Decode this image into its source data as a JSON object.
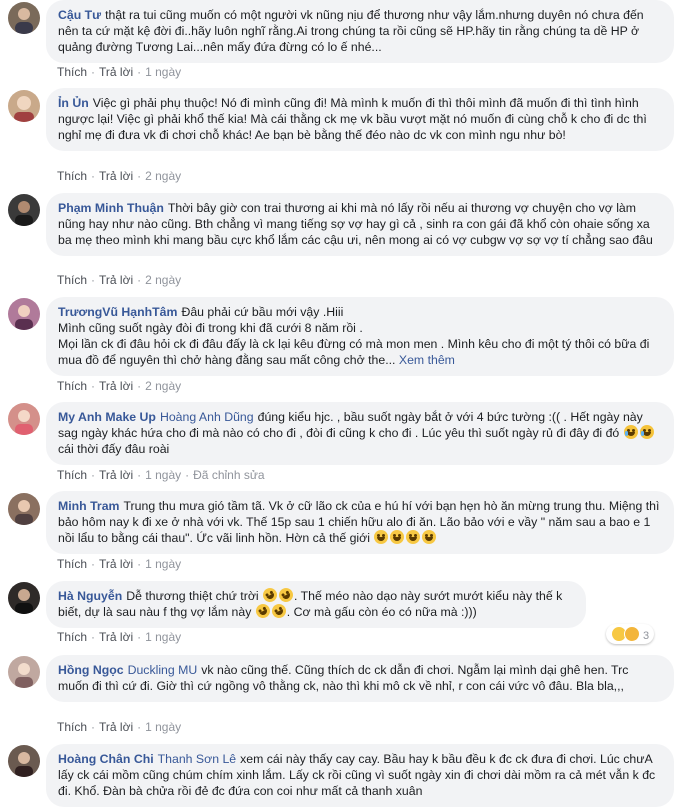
{
  "actions": {
    "like": "Thích",
    "reply": "Trả lời",
    "sep": "·"
  },
  "comments": [
    {
      "author": "Cậu Tư",
      "mention": "",
      "text": "thật ra tui cũng muốn có một người vk nũng nịu để thương như vậy lắm.nhưng duyên nó chưa đến nên ta cứ mặt kệ đời đi..hãy luôn nghĩ rằng.Ai trong chúng ta rồi cũng sẽ HP.hãy tin rằng chúng ta dề HP ở quảng đường Tương Lai...nên mấy đứa đừng có lo ế nhé...",
      "time": "1 ngày",
      "avatar_color": "#7a6a5a"
    },
    {
      "author": "Ỉn Ủn",
      "mention": "",
      "text": "Việc gì phải phụ thuộc! Nó đi mình cũng đi! Mà mình k muốn đi thì thôi mình đã muốn đi thì tình hình ngược lại! Việc gì phải khổ thế kia! Mà cái thằng ck mẹ vk bầu vượt mặt nó muốn đi cùng chỗ k cho đi dc thì nghỉ mẹ đi đưa vk đi chơi chỗ khác! Ae bạn bè bằng thế đéo nào dc vk con mình ngu như bò!",
      "time": "2 ngày",
      "avatar_color": "#c9a98a"
    },
    {
      "author": "Phạm Minh Thuận",
      "mention": "",
      "text": "Thời bây giờ con trai thương ai khi mà nó lấy rồi nếu ai thương vợ chuyện cho vợ làm nũng hay như nào cũng. Bth chẳng vì mang tiếng sợ vợ hay gì cả , sinh ra con gái đã khổ còn ohaie sống xa ba mẹ theo mình khi mang bầu cực khổ lắm các cậu ưi, nên mong ai có vợ cubgw vợ sợ vợ tí chẳng sao đâu",
      "time": "2 ngày",
      "avatar_color": "#3a3a3a"
    },
    {
      "author": "TrươngVũ HạnhTâm",
      "mention": "",
      "text": "Đâu phải cứ bầu mới vậy .Hiii",
      "text2": "Mình cũng suốt ngày đòi đi trong khi đã cưới 8 năm rồi .",
      "text3": "Mọi lần ck đi đâu hỏi ck đi đâu đấy là ck lại kêu đừng có mà mon men . Mình kêu cho đi một tý thôi có bữa đi mua đồ để nguyên thì chở hàng đằng sau mất công chở the...",
      "see_more": "Xem thêm",
      "time": "2 ngày",
      "avatar_color": "#b07a9a"
    },
    {
      "author": "My Anh Make Up",
      "mention": "Hoàng Anh Dũng",
      "text": "đúng kiểu hjc. , bầu suốt ngày bắt ở với 4 bức tường :(( . Hết ngày này sag ngày khác hứa cho đi mà nào có cho đi , đòi đi cũng k cho đi . Lúc yêu thì suốt ngày rủ đi đây đi đó",
      "text_end": "cái thời đấy đâu roài",
      "time": "1 ngày",
      "edited": "Đã chỉnh sửa",
      "avatar_color": "#d4908a"
    },
    {
      "author": "Minh Tram",
      "mention": "",
      "text": "Trung thu mưa gió tầm tã. Vk ở cữ lão ck của e hú hí với bạn hẹn hò ăn mừng trung thu. Miệng thì bảo hôm nay k đi xe ở nhà với vk. Thế 15p sau 1 chiến hữu alo đi ăn. Lão bảo với e vầy \" năm sau a bao e 1 nồi lẩu to bằng cái thau\". Ức vãi linh hồn. Hờn cả thế giới",
      "time": "1 ngày",
      "avatar_color": "#8a7060"
    },
    {
      "author": "Hà Nguyễn",
      "mention": "",
      "text": "Dễ thương thiệt chứ trời",
      "text_mid": ". Thế méo nào dạo này sướt mướt kiểu này thế k biết, dự là sau nàu f thg vợ lắm này",
      "text_end": ". Cơ mà gấu còn éo có nữa mà :)))",
      "time": "1 ngày",
      "reaction_count": "3",
      "avatar_color": "#2e2a28"
    },
    {
      "author": "Hồng Ngọc",
      "mention": "Duckling MU",
      "text": "vk nào cũng thế. Cũng thích dc ck dẫn đi chơi. Ngẫm lại mình dại ghê hen. Trc muốn đi thì cứ đi. Giờ thì cứ ngồng vô thằng ck, nào thì khi mô ck về nhỉ, r con cái vức vô đâu. Bla bla,,,",
      "time": "1 ngày",
      "avatar_color": "#c0a8a0"
    },
    {
      "author": "Hoàng Chân Chi",
      "mention": "Thanh Sơn Lê",
      "text": "xem cái này thấy cay cay. Bầu hay k bầu đều k đc ck đưa đi chơi. Lúc chưA lấy ck cái mồm cũng chúm chím xinh lắm. Lấy ck rồi cũng vì suốt ngày xin đi chơi dài mồm ra cả mét vẫn k đc đi. Khổ. Đàn bà chửa rồi đẻ đc đứa con coi như mất cả thanh xuân",
      "avatar_color": "#6a5a50"
    }
  ]
}
